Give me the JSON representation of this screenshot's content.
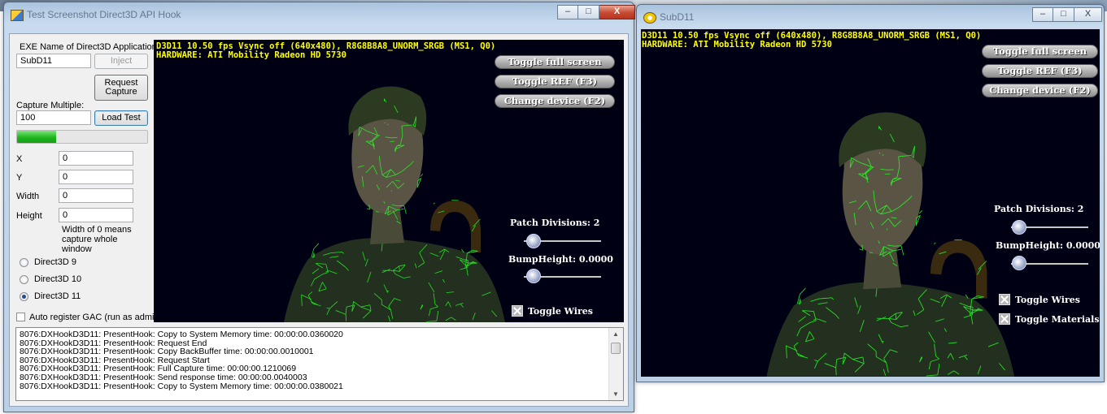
{
  "left_window": {
    "title": "Test Screenshot Direct3D API Hook",
    "caption_buttons": {
      "minimize": "–",
      "maximize": "□",
      "close": "X"
    },
    "exe_label": "EXE Name of Direct3D Application:",
    "exe_value": "SubD11",
    "inject_label": "Inject",
    "request_capture_line1": "Request",
    "request_capture_line2": "Capture",
    "capture_multiple_label": "Capture Multiple:",
    "capture_multiple_value": "100",
    "load_test_label": "Load Test",
    "progress_fraction": 0.3,
    "x_label": "X",
    "x_value": "0",
    "y_label": "Y",
    "y_value": "0",
    "width_label": "Width",
    "width_value": "0",
    "height_label": "Height",
    "height_value": "0",
    "width_note_1": "Width of 0 means",
    "width_note_2": "capture whole",
    "width_note_3": "window",
    "radio_d3d9": "Direct3D 9",
    "radio_d3d10": "Direct3D 10",
    "radio_d3d11": "Direct3D 11",
    "selected_api": "Direct3D 11",
    "auto_register_label": "Auto register GAC (run as admin)",
    "log_lines": [
      "8076:DXHookD3D11: PresentHook: Copy to System Memory time: 00:00:00.0360020",
      "8076:DXHookD3D11: PresentHook: Request End",
      "8076:DXHookD3D11: PresentHook: Copy BackBuffer time: 00:00:00.0010001",
      "8076:DXHookD3D11: PresentHook: Request Start",
      "8076:DXHookD3D11: PresentHook: Full Capture time: 00:00:00.1210069",
      "8076:DXHookD3D11: PresentHook: Send response time: 00:00:00.0040003",
      "8076:DXHookD3D11: PresentHook: Copy to System Memory time: 00:00:00.0380021"
    ]
  },
  "preview": {
    "stats_line1": "D3D11 10.50 fps Vsync off (640x480), R8G8B8A8_UNORM_SRGB (MS1, Q0)",
    "stats_line2": "HARDWARE: ATI Mobility Radeon HD 5730",
    "toggle_full_screen": "Toggle full screen",
    "toggle_ref": "Toggle REF (F3)",
    "change_device": "Change device (F2)",
    "patch_divisions": "Patch Divisions: 2",
    "bump_height": "BumpHeight: 0.0000",
    "toggle_wires": "Toggle Wires"
  },
  "right_window": {
    "title": "SubD11",
    "caption_buttons": {
      "minimize": "–",
      "maximize": "□",
      "close": "X"
    },
    "stats_line1": "D3D11 10.50 fps Vsync off (640x480), R8G8B8A8_UNORM_SRGB (MS1, Q0)",
    "stats_line2": "HARDWARE: ATI Mobility Radeon HD 5730",
    "toggle_full_screen": "Toggle full screen",
    "toggle_ref": "Toggle REF (F3)",
    "change_device": "Change device (F2)",
    "patch_divisions": "Patch Divisions: 2",
    "bump_height": "BumpHeight: 0.0000",
    "toggle_wires": "Toggle Wires",
    "toggle_materials": "Toggle Materials"
  },
  "colors": {
    "hud_text": "#ffff00",
    "wireframe": "#22ff22",
    "viewport_bg": "#000015",
    "progress": "#1fb51f"
  }
}
